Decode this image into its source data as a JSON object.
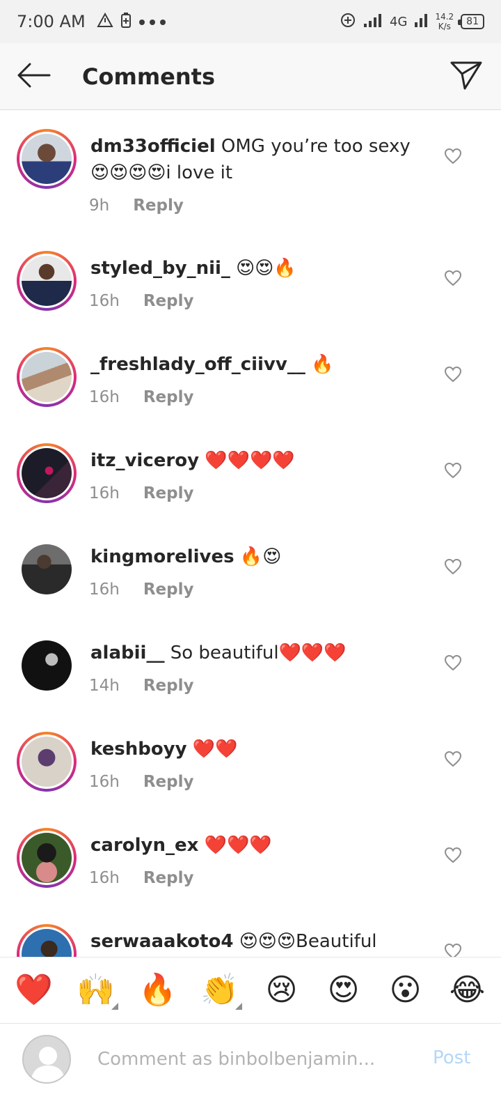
{
  "status_bar": {
    "time": "7:00 AM",
    "network": "4G",
    "speed_value": "14.2",
    "speed_unit": "K/s",
    "battery": "81"
  },
  "header": {
    "title": "Comments"
  },
  "comments": [
    {
      "username": "dm33officiel",
      "text": "OMG you’re too sexy😍😍😍😍i love it",
      "time": "9h",
      "reply": "Reply"
    },
    {
      "username": "styled_by_nii_",
      "text": "😍😍🔥",
      "time": "16h",
      "reply": "Reply"
    },
    {
      "username": "_freshlady_off_ciivv__",
      "text": "🔥",
      "time": "16h",
      "reply": "Reply"
    },
    {
      "username": "itz_viceroy",
      "text": "❤️❤️❤️❤️",
      "time": "16h",
      "reply": "Reply"
    },
    {
      "username": "kingmorelives",
      "text": "🔥😍",
      "time": "16h",
      "reply": "Reply"
    },
    {
      "username": "alabii__",
      "text": "So beautiful❤️❤️❤️",
      "time": "14h",
      "reply": "Reply"
    },
    {
      "username": "keshboyy",
      "text": "❤️❤️",
      "time": "16h",
      "reply": "Reply"
    },
    {
      "username": "carolyn_ex",
      "text": "❤️❤️❤️",
      "time": "16h",
      "reply": "Reply"
    },
    {
      "username": "serwaaakoto4",
      "text": "😍😍😍Beautiful",
      "time": "",
      "reply": ""
    }
  ],
  "emoji_bar": [
    "❤️",
    "🙌",
    "🔥",
    "👏",
    "😢",
    "😍",
    "😮",
    "😂"
  ],
  "composer": {
    "placeholder": "Comment as binbolbenjamin...",
    "post_label": "Post"
  },
  "colors": {
    "ring_start": "#f58529",
    "ring_mid": "#dd2a7b",
    "post_disabled": "#b3d7f7",
    "meta_gray": "#8e8e8e"
  }
}
